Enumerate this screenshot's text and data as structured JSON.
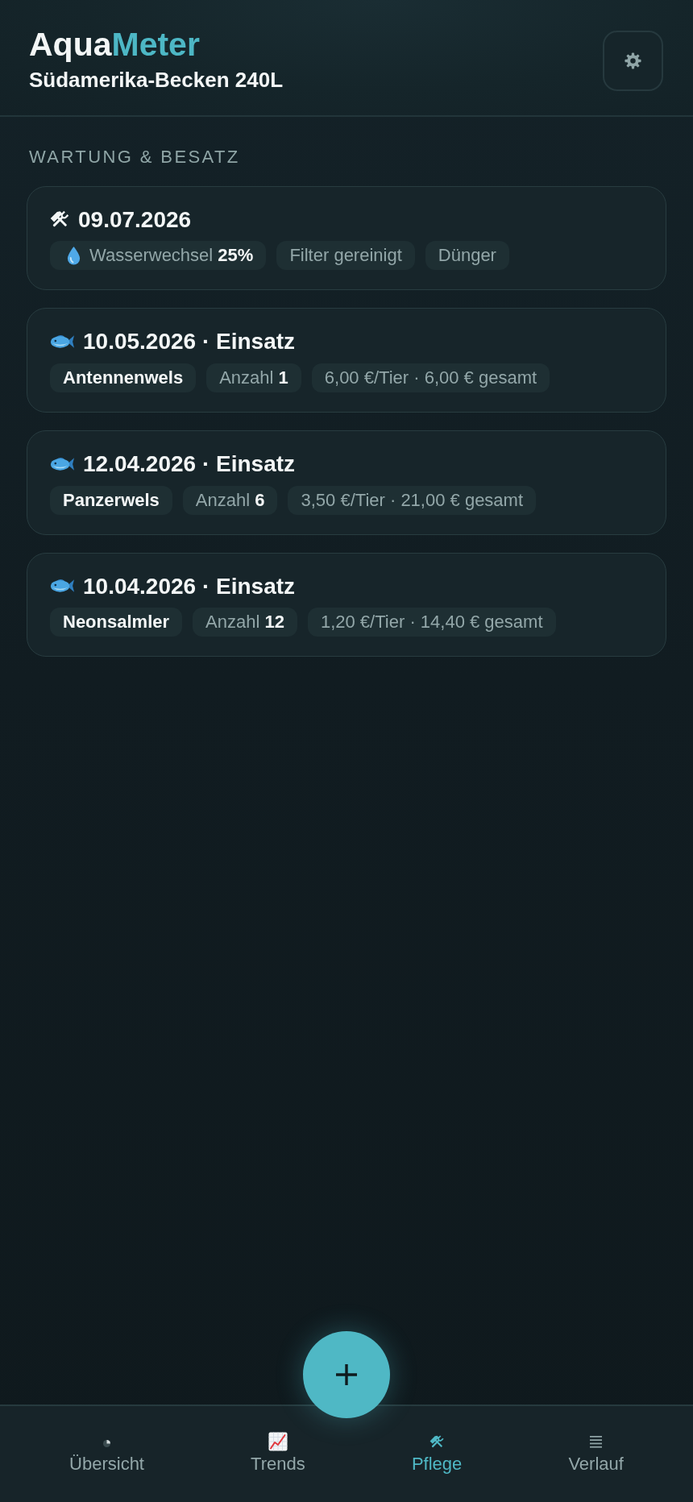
{
  "header": {
    "title_main": "Aqua",
    "title_accent": "Meter",
    "subtitle": "Südamerika-Becken 240L"
  },
  "section": {
    "title": "WARTUNG & BESATZ",
    "entries": [
      {
        "kind": "maintenance",
        "title": "09.07.2026",
        "chips": [
          {
            "kind": "water_change",
            "text": "Wasserwechsel **25%**"
          },
          {
            "kind": "task",
            "text": "Filter gereinigt"
          },
          {
            "kind": "task",
            "text": "Dünger"
          }
        ]
      },
      {
        "kind": "stocking",
        "title": "10.05.2026 · Einsatz",
        "chips": [
          {
            "kind": "species",
            "text": "Antennenwels"
          },
          {
            "kind": "count",
            "text": "Anzahl **1**"
          },
          {
            "kind": "price",
            "text": "6,00 €/Tier · 6,00 € gesamt"
          }
        ]
      },
      {
        "kind": "stocking",
        "title": "12.04.2026 · Einsatz",
        "chips": [
          {
            "kind": "species",
            "text": "Panzerwels"
          },
          {
            "kind": "count",
            "text": "Anzahl **6**"
          },
          {
            "kind": "price",
            "text": "3,50 €/Tier · 21,00 € gesamt"
          }
        ]
      },
      {
        "kind": "stocking",
        "title": "10.04.2026 · Einsatz",
        "chips": [
          {
            "kind": "species",
            "text": "Neonsalmler"
          },
          {
            "kind": "count",
            "text": "Anzahl **12**"
          },
          {
            "kind": "price",
            "text": "1,20 €/Tier · 14,40 € gesamt"
          }
        ]
      }
    ]
  },
  "nav": {
    "items": [
      {
        "kind": "overview",
        "label": "Übersicht",
        "selected": false
      },
      {
        "kind": "trends",
        "label": "Trends",
        "selected": false
      },
      {
        "kind": "care",
        "label": "Pflege",
        "selected": true
      },
      {
        "kind": "history",
        "label": "Verlauf",
        "selected": false
      }
    ]
  }
}
